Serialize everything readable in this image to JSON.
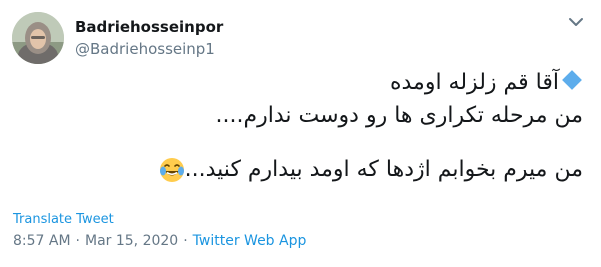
{
  "user": {
    "display_name": "Badriehosseinpor",
    "handle": "@Badriehosseinp1"
  },
  "tweet": {
    "line1": "آقا قم زلزله اومده",
    "line2": "من مرحله تکراری ها رو دوست ندارم....",
    "line3": "من میرم بخوابم اژدها که اومد بیدارم کنید...",
    "icons": [
      "large-blue-diamond-icon",
      "laughing-tears-emoji-icon"
    ]
  },
  "actions": {
    "translate_label": "Translate Tweet"
  },
  "meta": {
    "time": "8:57 AM",
    "separator1": "·",
    "date": "Mar 15, 2020",
    "separator2": "·",
    "source": "Twitter Web App"
  },
  "colors": {
    "accent": "#1b95e0",
    "secondary_text": "#657786",
    "primary_text": "#14171a",
    "diamond": "#5dadec"
  }
}
